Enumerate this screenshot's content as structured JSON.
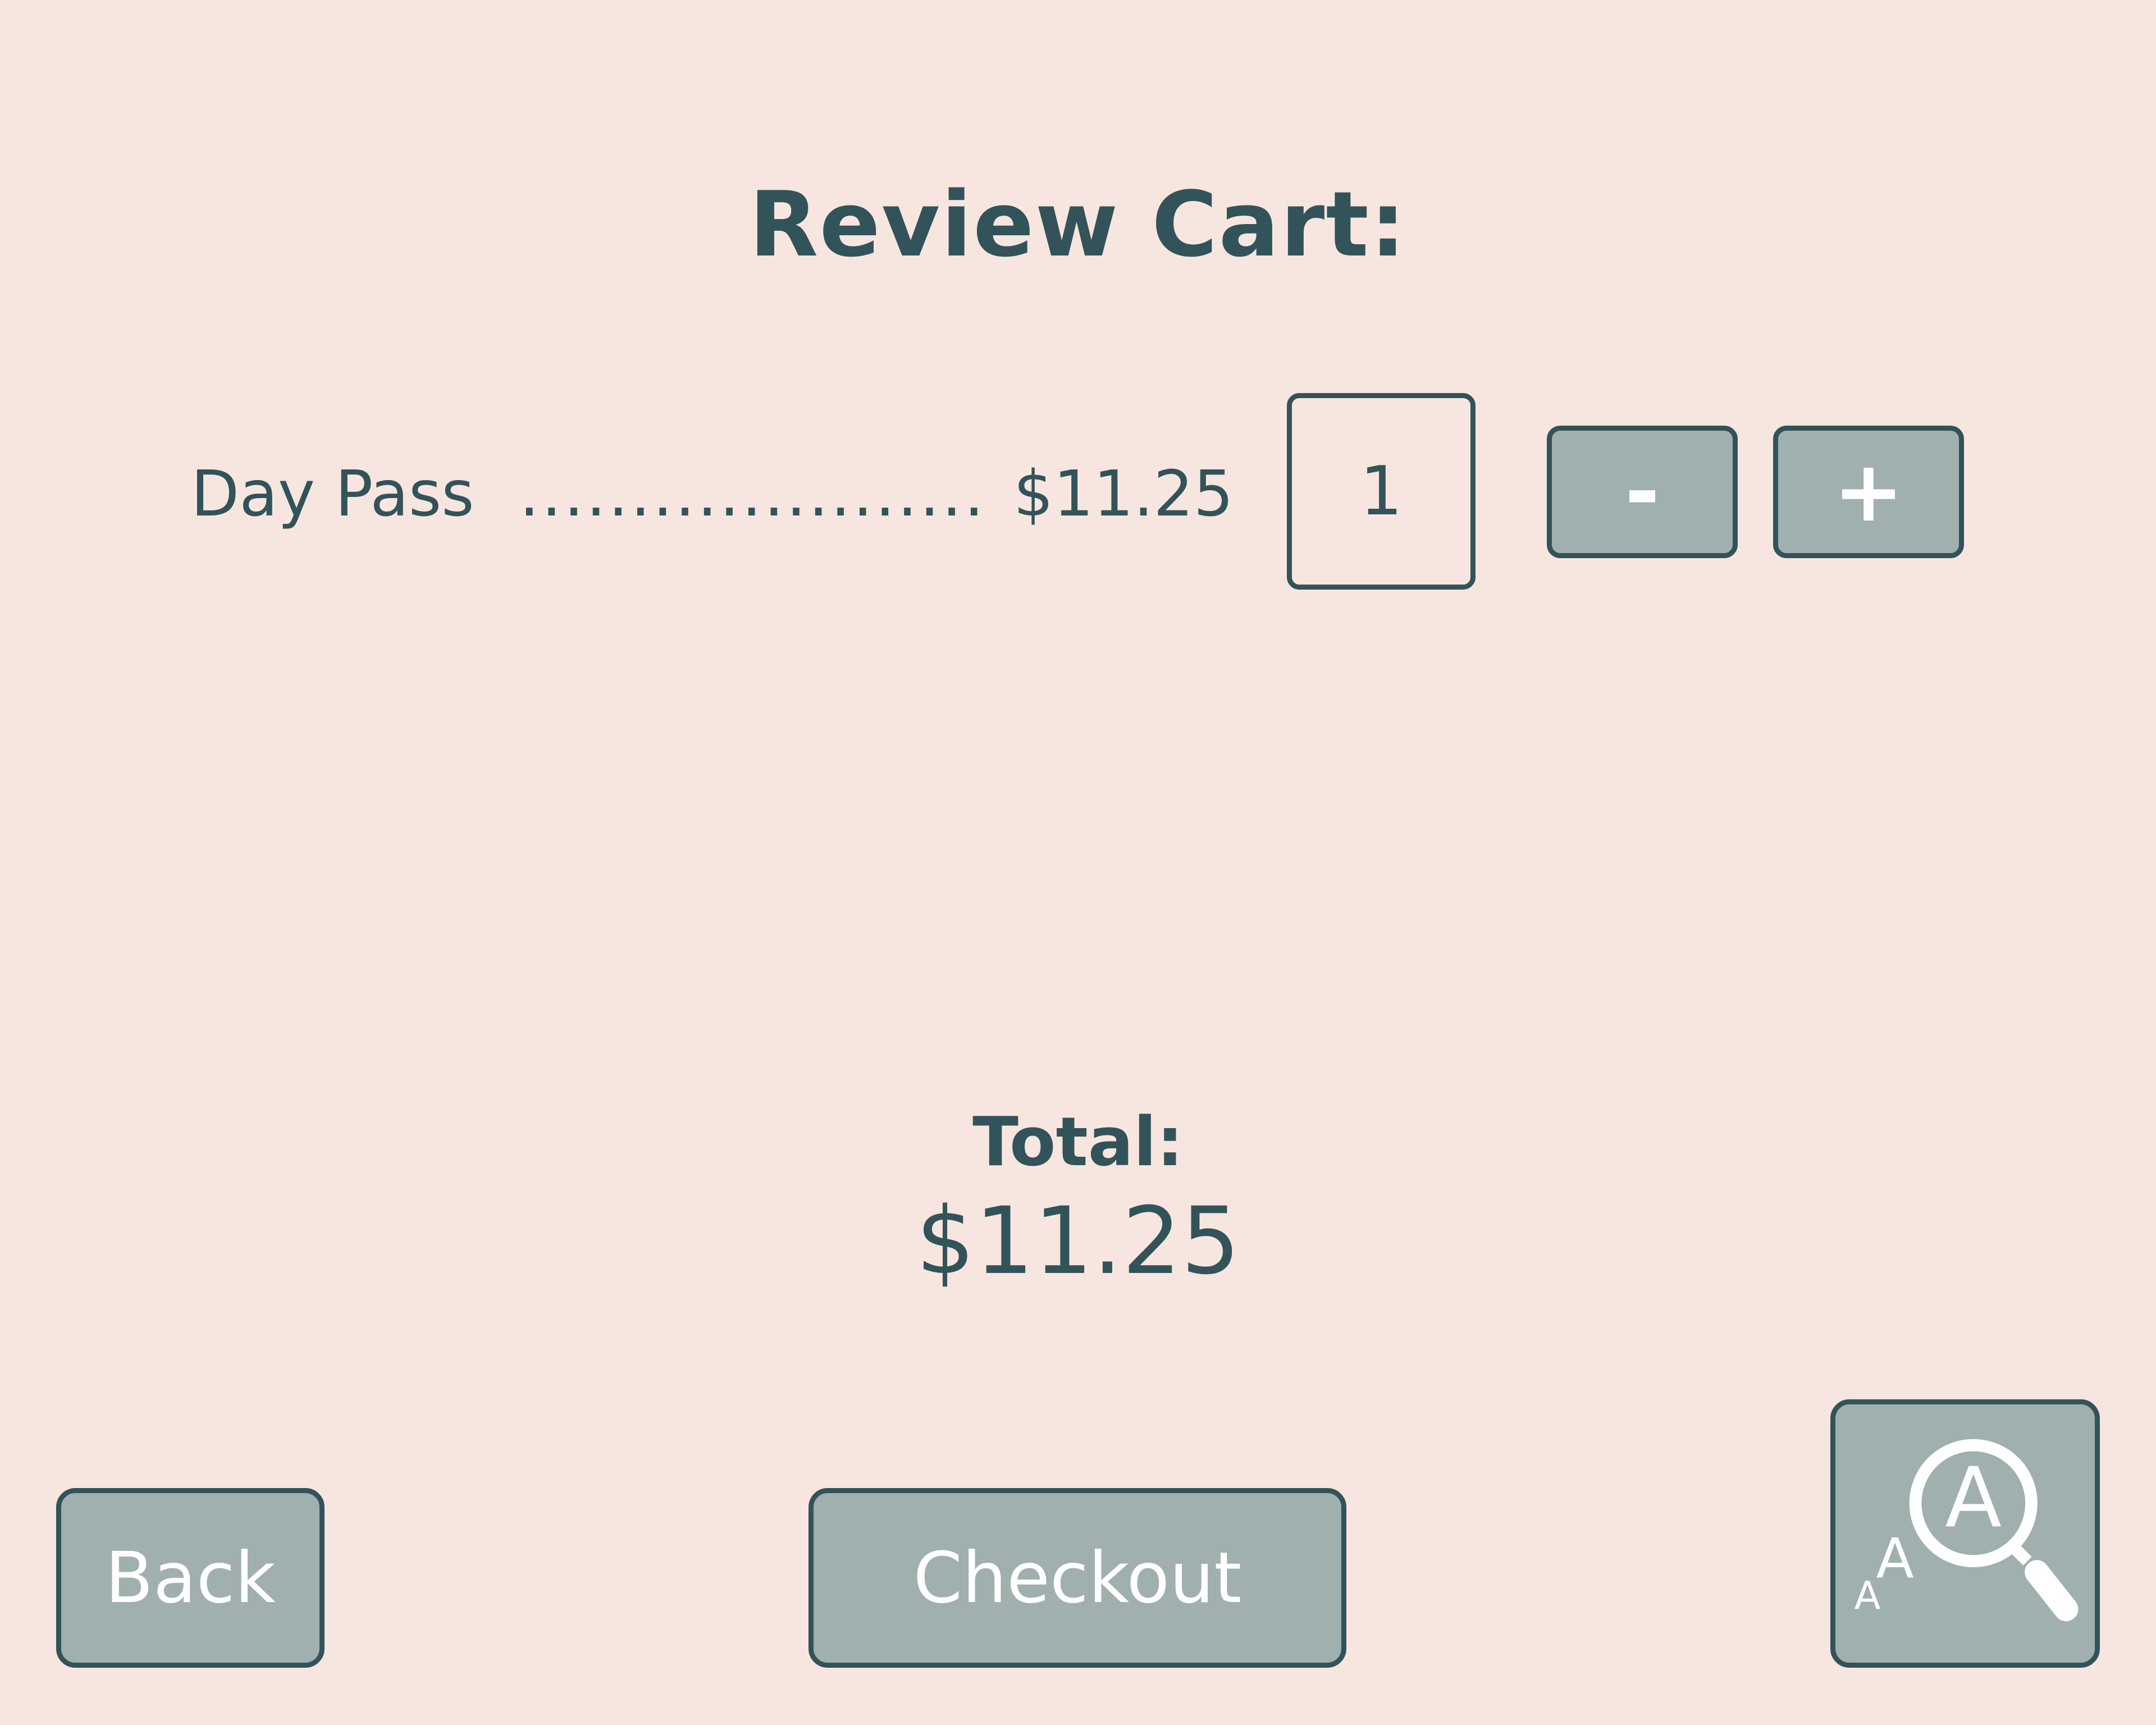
{
  "page": {
    "title": "Review Cart:"
  },
  "cart": {
    "items": [
      {
        "name": "Day Pass",
        "leader": "..........................",
        "price": "$11.25",
        "quantity": "1",
        "decrement_label": "-",
        "increment_label": "+"
      }
    ]
  },
  "total": {
    "label": "Total:",
    "value": "$11.25"
  },
  "footer": {
    "back_label": "Back",
    "checkout_label": "Checkout",
    "accessibility_icon": "text-size-magnifier-icon",
    "accessibility_glyphs": {
      "small": "A",
      "medium": "A",
      "large": "A"
    }
  },
  "colors": {
    "background": "#f7e6df",
    "text": "#32535a",
    "button_fill": "#a0b0ae",
    "button_text": "#ffffff"
  }
}
